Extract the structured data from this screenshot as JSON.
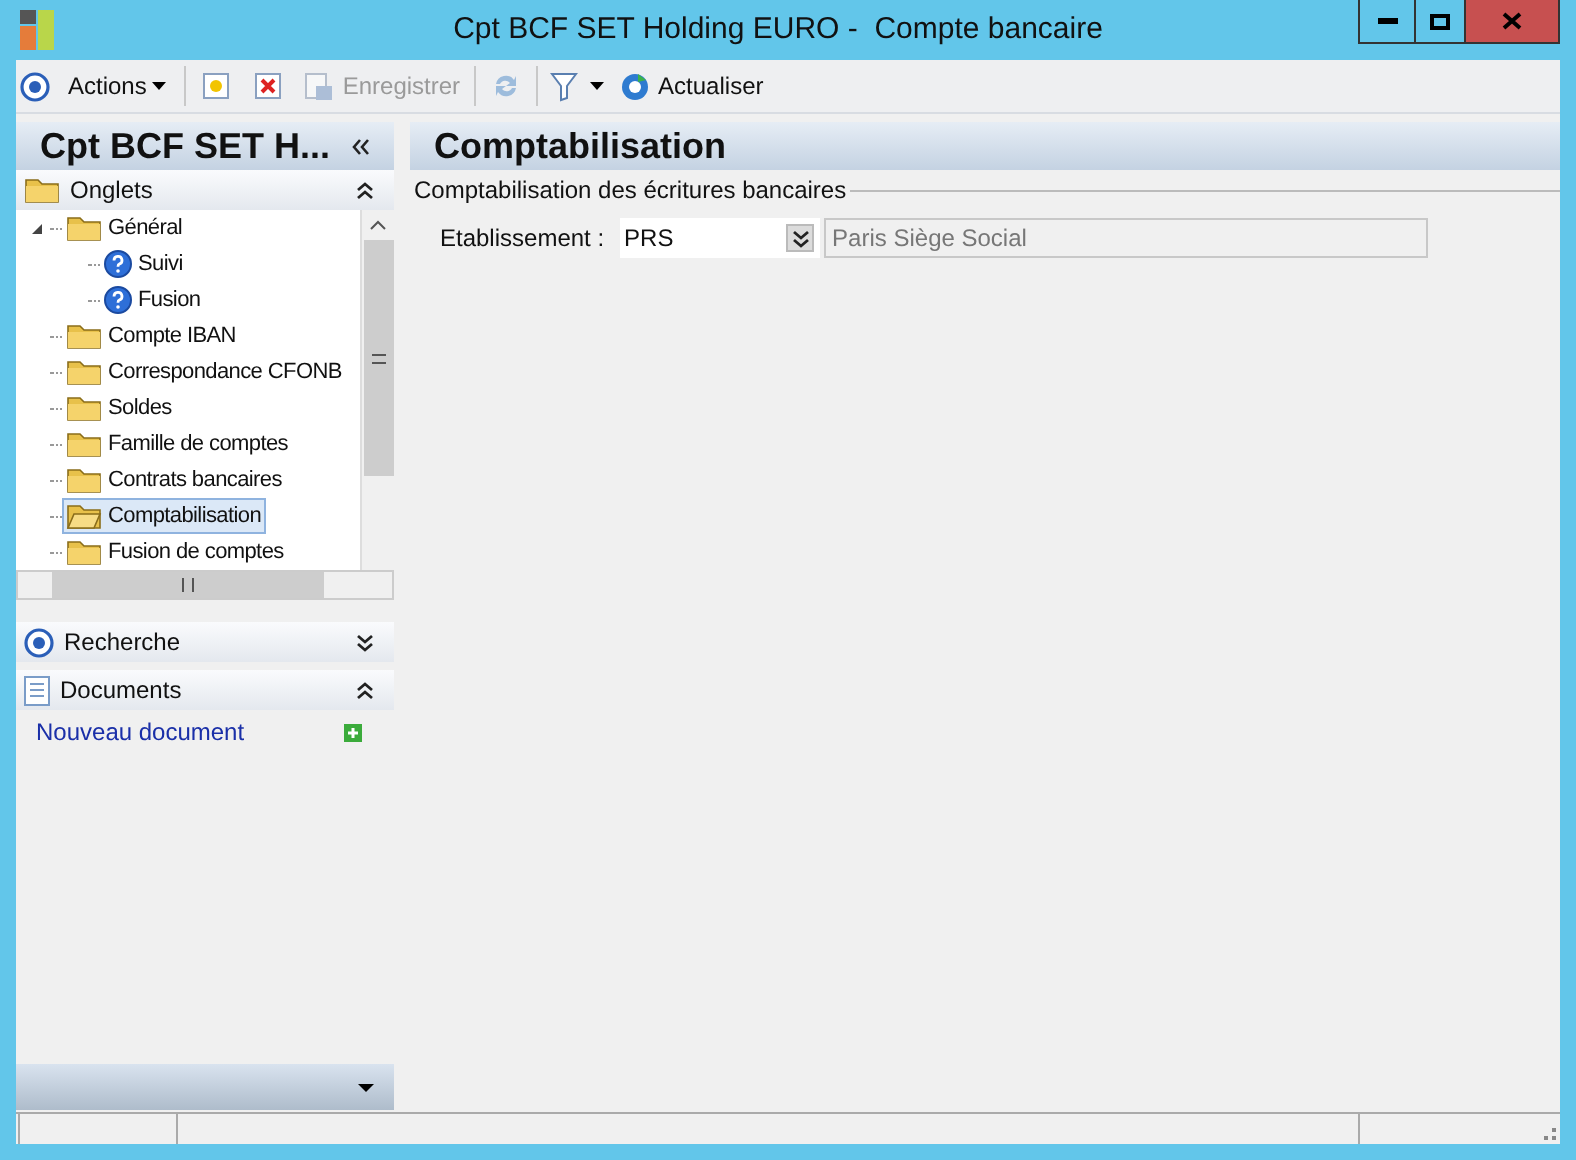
{
  "window": {
    "title": "Cpt BCF SET Holding EURO -  Compte bancaire"
  },
  "toolbar": {
    "actions_label": "Actions",
    "save": {
      "label": "Enregistrer",
      "disabled": true
    },
    "refresh_disabled": true,
    "reload_label": "Actualiser"
  },
  "sidebar": {
    "title": "Cpt BCF SET H...",
    "sections": [
      {
        "kind": "tabs",
        "title": "Onglets",
        "expanded": true
      },
      {
        "kind": "search",
        "title": "Recherche",
        "expanded": false
      },
      {
        "kind": "documents",
        "title": "Documents",
        "expanded": true
      }
    ],
    "tree": [
      {
        "kind": "folder",
        "label": "Général",
        "selected": false,
        "expanded": true,
        "children": [
          {
            "kind": "help",
            "label": "Suivi",
            "selected": false
          },
          {
            "kind": "help",
            "label": "Fusion",
            "selected": false
          }
        ]
      },
      {
        "kind": "folder",
        "label": "Compte IBAN",
        "selected": false
      },
      {
        "kind": "folder",
        "label": "Correspondance CFONB",
        "selected": false
      },
      {
        "kind": "folder",
        "label": "Soldes",
        "selected": false
      },
      {
        "kind": "folder",
        "label": "Famille de comptes",
        "selected": false
      },
      {
        "kind": "folder",
        "label": "Contrats bancaires",
        "selected": false
      },
      {
        "kind": "folder",
        "label": "Comptabilisation",
        "selected": true
      },
      {
        "kind": "folder",
        "label": "Fusion de comptes",
        "selected": false
      }
    ],
    "documents_link": "Nouveau document"
  },
  "main": {
    "title": "Comptabilisation",
    "group_title": "Comptabilisation des écritures bancaires",
    "field": {
      "label": "Etablissement :",
      "value": "PRS",
      "description": "Paris Siège Social"
    }
  }
}
